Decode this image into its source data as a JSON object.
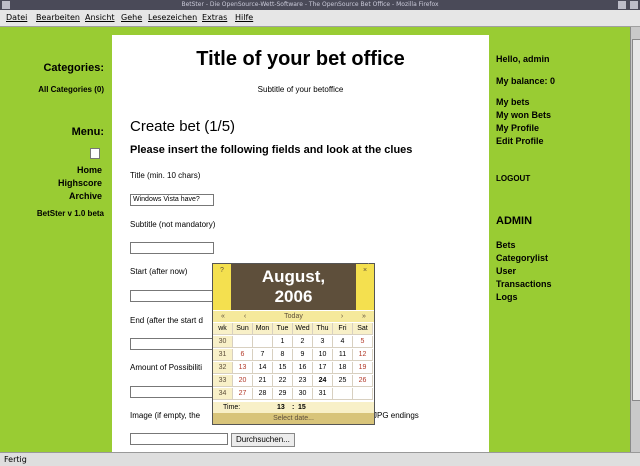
{
  "window": {
    "title": "BetSter - Die OpenSource-Wett-Software - The OpenSource Bet Office - Mozilla Firefox"
  },
  "menu": [
    "Datei",
    "Bearbeiten",
    "Ansicht",
    "Gehe",
    "Lesezeichen",
    "Extras",
    "Hilfe"
  ],
  "left": {
    "categories_heading": "Categories:",
    "all_categories": "All Categories (0)",
    "menu_heading": "Menu:",
    "links": [
      "Home",
      "Highscore",
      "Archive"
    ],
    "version": "BetSter v 1.0 beta"
  },
  "main": {
    "title": "Title of your bet office",
    "subtitle": "Subtitle of your betoffice",
    "heading": "Create bet (1/5)",
    "instruction": "Please insert the following fields and look at the clues",
    "fields": {
      "title_label": "Title (min. 10 chars)",
      "title_value": "Windows Vista have?",
      "subtitle_label": "Subtitle (not mandatory)",
      "start_label": "Start (after now)",
      "end_label": "End (after the start d",
      "amount_label": "Amount of Possibiliti",
      "image_label": "Image (if empty, the",
      "image_label_end": "JPG endings",
      "browse_button": "Durchsuchen..."
    }
  },
  "right": {
    "greeting": "Hello, admin",
    "balance": "My balance: 0",
    "user_links": [
      "My bets",
      "My won Bets",
      "My Profile",
      "Edit Profile"
    ],
    "logout": "LOGOUT",
    "admin_heading": "ADMIN",
    "admin_links": [
      "Bets",
      "Categorylist",
      "User",
      "Transactions",
      "Logs"
    ]
  },
  "calendar": {
    "help": "?",
    "close": "×",
    "month": "August,",
    "year": "2006",
    "nav": {
      "prev_year": "«",
      "prev_month": "‹",
      "today": "Today",
      "next_month": "›",
      "next_year": "»"
    },
    "headers": [
      "wk",
      "Sun",
      "Mon",
      "Tue",
      "Wed",
      "Thu",
      "Fri",
      "Sat"
    ],
    "weeks": [
      [
        "30",
        "",
        "",
        "1",
        "2",
        "3",
        "4",
        "5"
      ],
      [
        "31",
        "6",
        "7",
        "8",
        "9",
        "10",
        "11",
        "12"
      ],
      [
        "32",
        "13",
        "14",
        "15",
        "16",
        "17",
        "18",
        "19"
      ],
      [
        "33",
        "20",
        "21",
        "22",
        "23",
        "24",
        "25",
        "26"
      ],
      [
        "34",
        "27",
        "28",
        "29",
        "30",
        "31",
        "",
        ""
      ]
    ],
    "today_day": "24",
    "time_label": "Time:",
    "hour": "13",
    "minute": "15",
    "footer": "Select date..."
  },
  "status": {
    "text": "Fertig"
  }
}
